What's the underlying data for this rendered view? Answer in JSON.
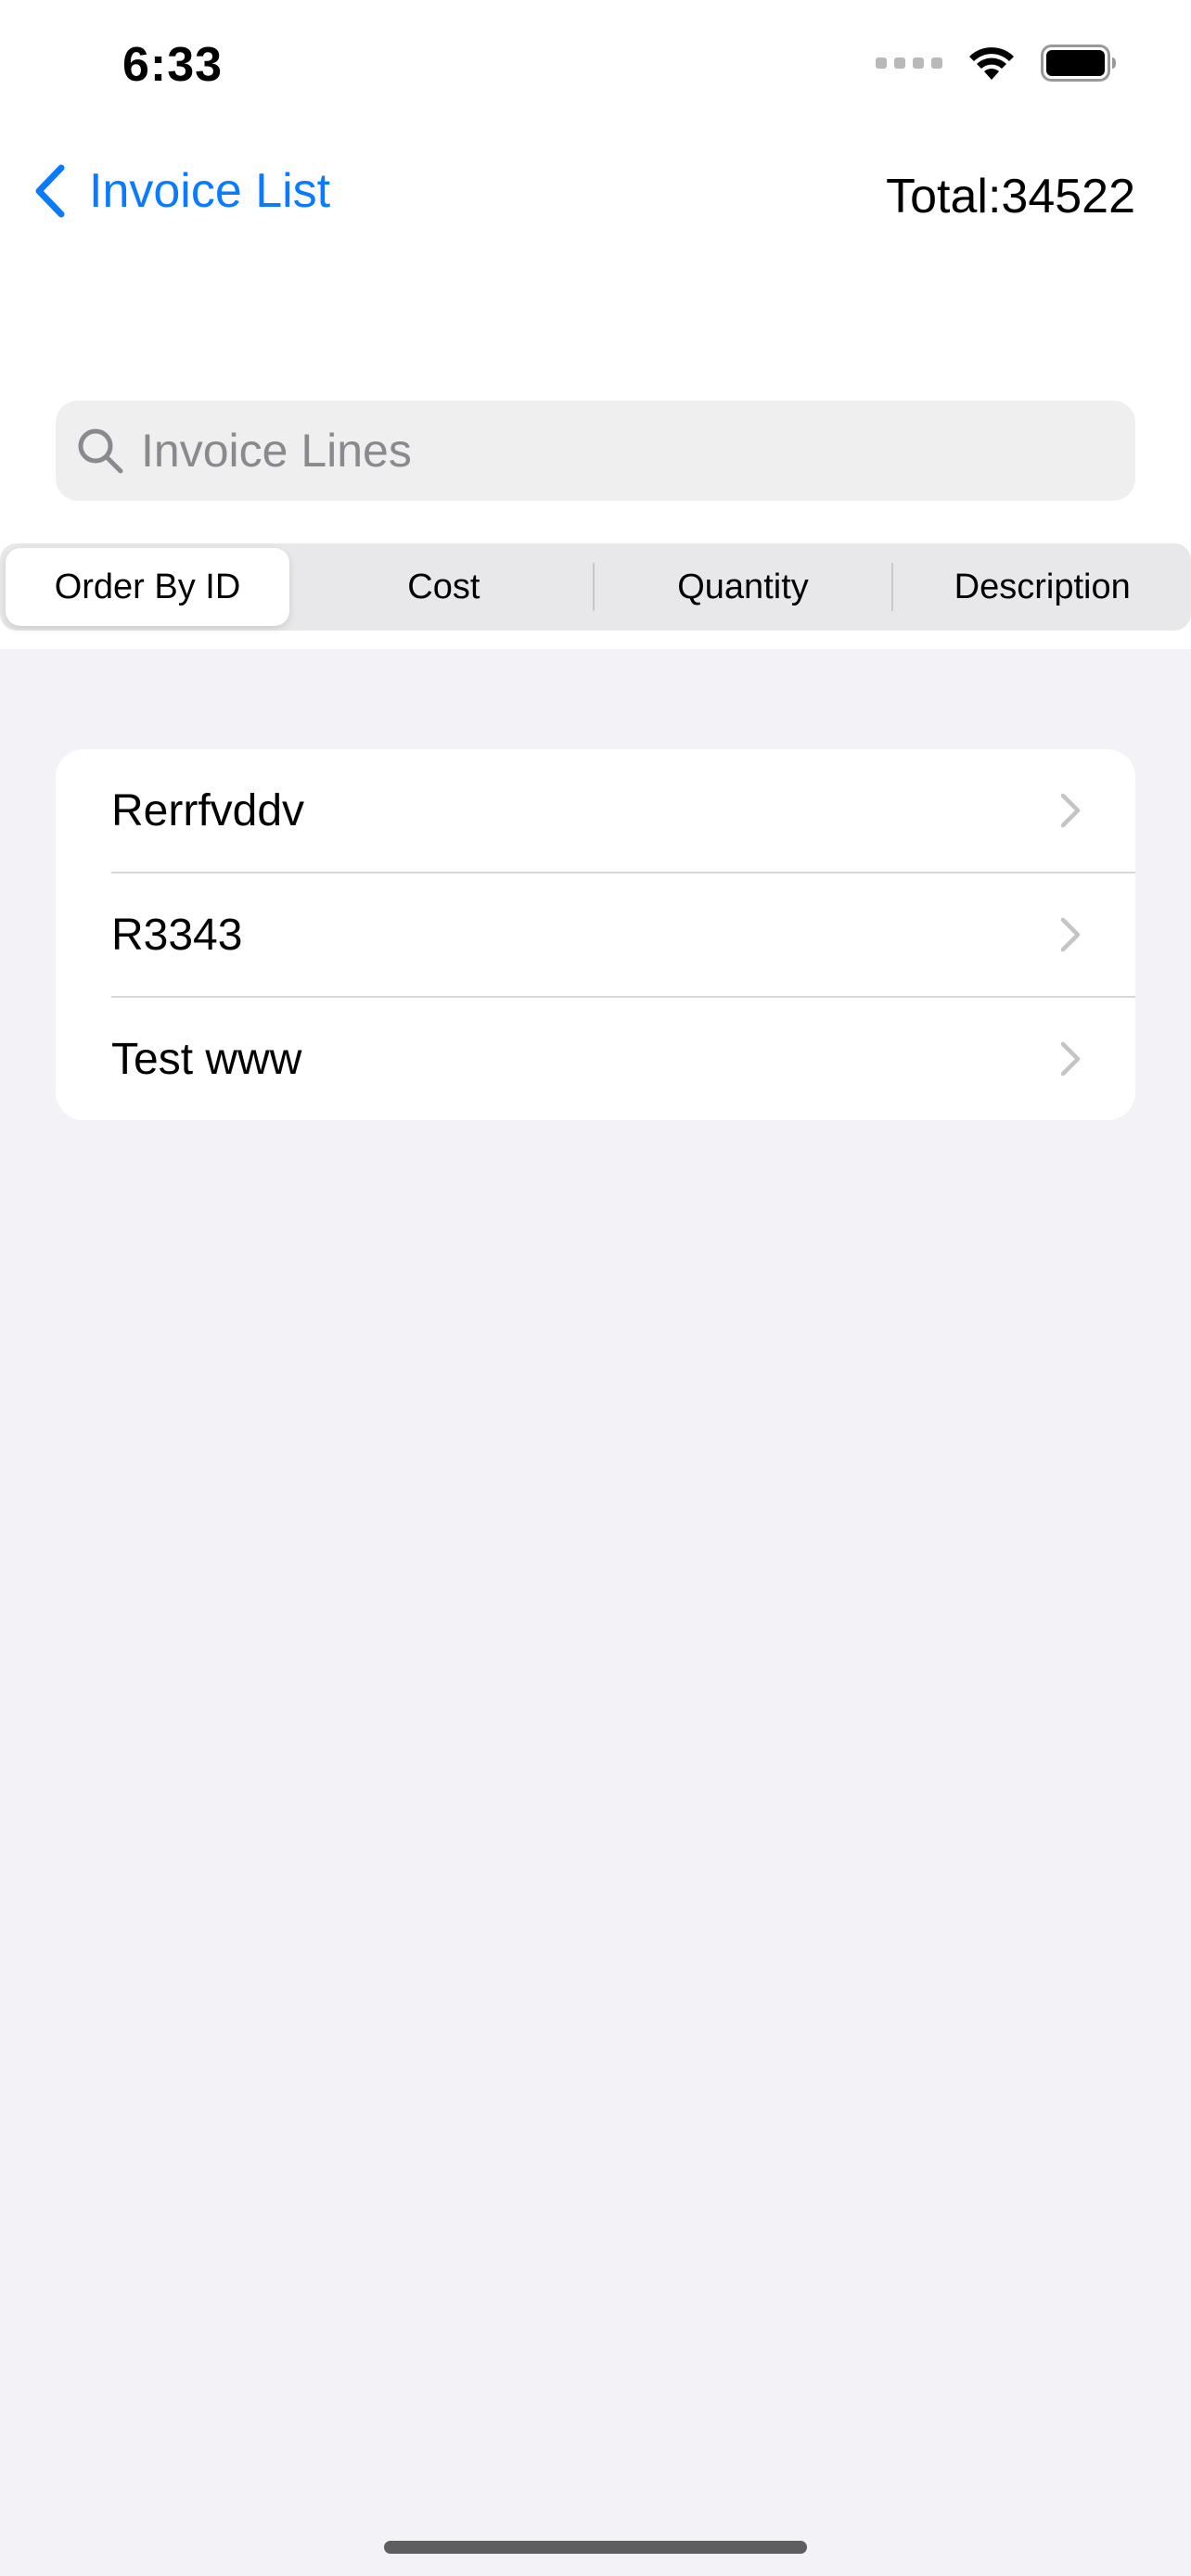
{
  "status_bar": {
    "time": "6:33",
    "icons": [
      "signal-dots-icon",
      "wifi-icon",
      "battery-icon"
    ]
  },
  "nav": {
    "back_label": "Invoice List",
    "total_text": "Total:34522"
  },
  "search": {
    "placeholder": "Invoice Lines",
    "value": ""
  },
  "segments": [
    {
      "label": "Order By ID",
      "selected": true
    },
    {
      "label": "Cost",
      "selected": false
    },
    {
      "label": "Quantity",
      "selected": false
    },
    {
      "label": "Description",
      "selected": false
    }
  ],
  "list": {
    "items": [
      {
        "label": "Rerrfvddv"
      },
      {
        "label": "R3343"
      },
      {
        "label": "Test www"
      }
    ]
  },
  "colors": {
    "accent": "#0a7aff",
    "background": "#f2f2f7",
    "card": "#ffffff"
  }
}
